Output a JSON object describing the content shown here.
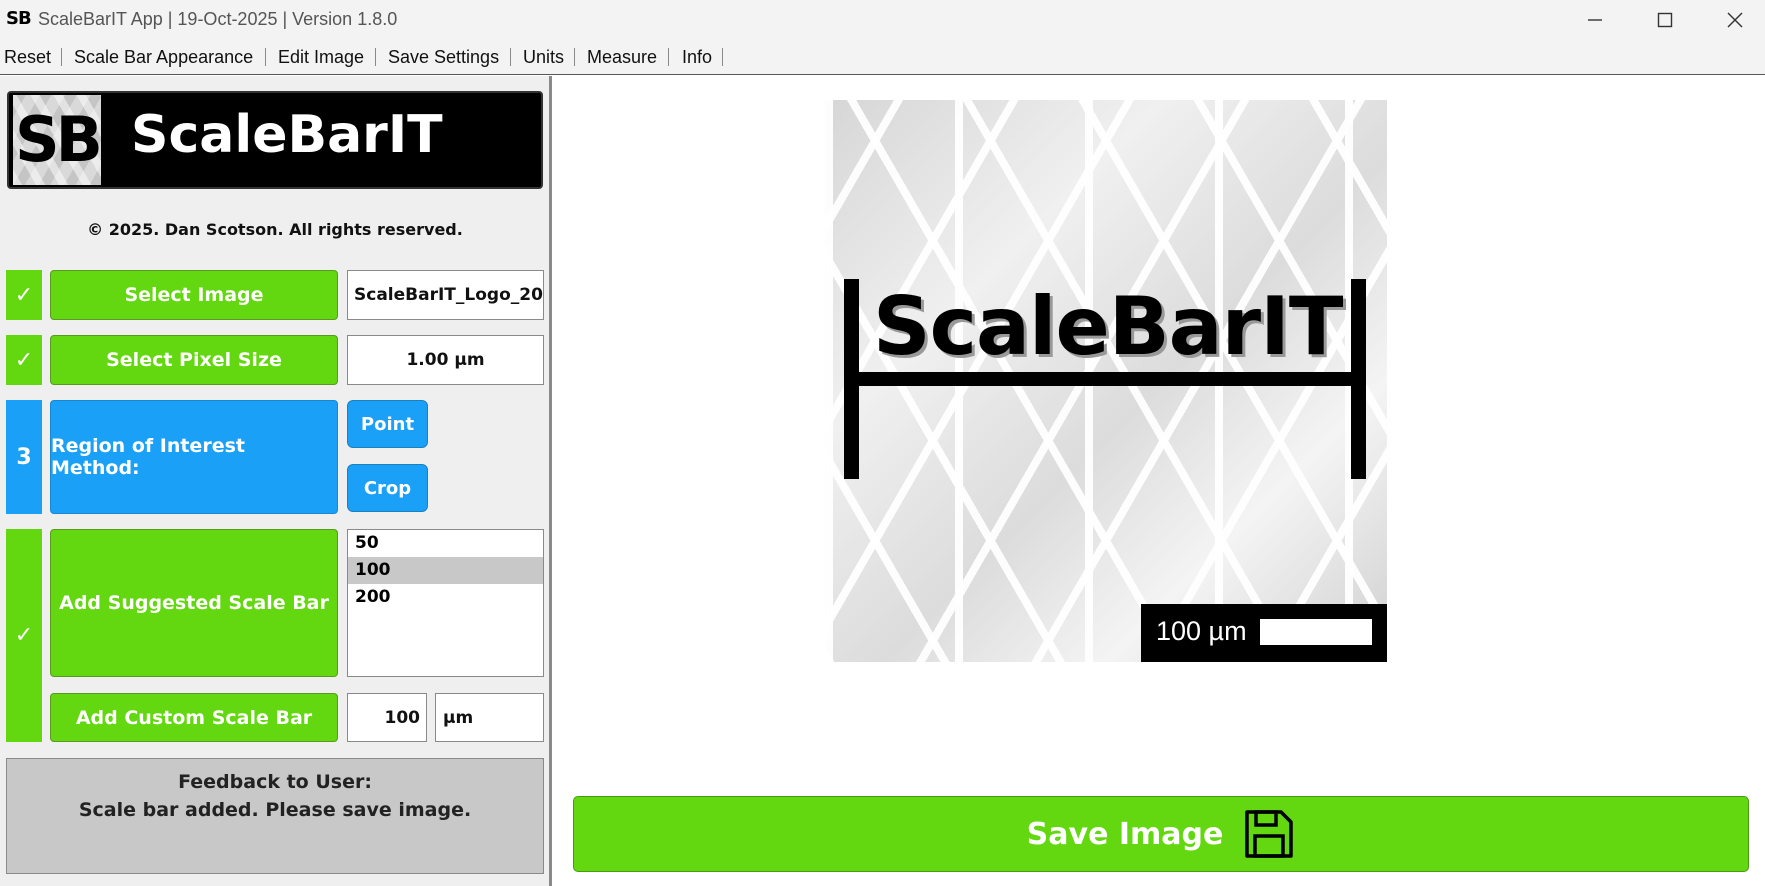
{
  "window": {
    "icon_text": "SB",
    "title": "ScaleBarIT App | 19-Oct-2025 | Version 1.8.0",
    "controls": [
      "minimize-icon",
      "maximize-icon",
      "close-icon"
    ]
  },
  "menu": {
    "items": [
      "Reset",
      "Scale Bar Appearance",
      "Edit Image",
      "Save Settings",
      "Units",
      "Measure",
      "Info"
    ]
  },
  "sidebar": {
    "logo_icon": "SB",
    "logo_text": "ScaleBarIT",
    "copyright": "© 2025. Dan Scotson. All rights reserved.",
    "steps": {
      "select_image": {
        "status": "✓",
        "button": "Select Image",
        "value": "ScaleBarIT_Logo_20"
      },
      "pixel_size": {
        "status": "✓",
        "button": "Select Pixel Size",
        "value": "1.00 µm"
      },
      "roi": {
        "status": "3",
        "label": "Region of Interest Method:",
        "point": "Point",
        "crop": "Crop"
      },
      "scale_bar": {
        "status": "✓",
        "suggested_button": "Add Suggested Scale Bar",
        "options": [
          "50",
          "100",
          "200"
        ],
        "selected": "100",
        "custom_button": "Add Custom Scale Bar",
        "custom_value": "100",
        "custom_unit": "µm"
      }
    },
    "feedback": {
      "title": "Feedback to User:",
      "message": "Scale bar added. Please save image."
    }
  },
  "preview": {
    "image_text": "ScaleBarIT",
    "scale_label": "100 µm"
  },
  "save": {
    "label": "Save Image",
    "icon": "floppy-disk-icon"
  },
  "colors": {
    "green": "#63d70f",
    "blue": "#1aa0f7",
    "feedback_bg": "#c8c8c8"
  }
}
